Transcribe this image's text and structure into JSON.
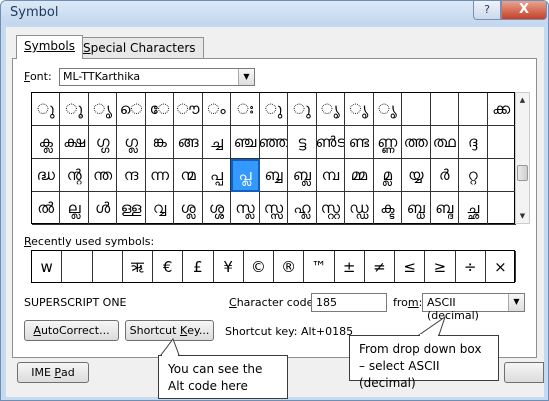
{
  "window": {
    "title": "Symbol",
    "help_glyph": "?",
    "close_glyph": "X"
  },
  "tabs": [
    {
      "label": "Symbols"
    },
    {
      "prefix": "S",
      "label_rest": "pecial Characters"
    }
  ],
  "font": {
    "label_key": "F",
    "label_rest": "ont:",
    "value": "ML-TTKarthika"
  },
  "symbol_grid": [
    [
      "ു",
      "ൂ",
      "ൃ",
      "െ",
      "േ",
      "ൗ",
      "ം",
      "ഃ",
      "ു",
      "ു",
      "ൃ",
      "ൃ",
      "ൃ",
      "",
      "",
      "",
      "ക്ക"
    ],
    [
      "ക്ല",
      "ക്ഷ",
      "ഗ്ഗ",
      "ഗ്ല",
      "ങ്ക",
      "ങ്ങ",
      "ച്ച",
      "ഞ്ച",
      "ഞ്ഞ",
      "ട്ട",
      "ൺട",
      "ണ്ട",
      "ണ്ണ",
      "ത്ത",
      "ത്ഥ",
      "ദ്ദ",
      ""
    ],
    [
      "ദ്ധ",
      "ന്റ",
      "ന്ത",
      "ന്ദ",
      "ന്ന",
      "ന്മ",
      "പ്പ",
      "പ്ല",
      "ബ്ബ",
      "ബ്ല",
      "മ്പ",
      "മ്മ",
      "മ്ല",
      "യ്യ",
      "ർ",
      "റ്റ",
      ""
    ],
    [
      "ൽ",
      "ല്ല",
      "ൾ",
      "ള്ള",
      "വ്വ",
      "ശ്ല",
      "ശ്ശ",
      "സ്ല",
      "സ്സ",
      "ഹ്ല",
      "സ്റ്റ",
      "ഡ്ഡ",
      "ക്ട",
      "ബ്ധ",
      "ബ്ദ",
      "ച്ഛ",
      ""
    ]
  ],
  "selected_cell": {
    "row": 2,
    "col": 7
  },
  "recent": {
    "label_key": "R",
    "label_rest": "ecently used symbols:",
    "symbols": [
      "w",
      "",
      "",
      "ऋ",
      "€",
      "£",
      "¥",
      "©",
      "®",
      "™",
      "±",
      "≠",
      "≤",
      "≥",
      "÷",
      "×"
    ]
  },
  "char_name": "SUPERSCRIPT ONE",
  "char_code": {
    "label_key": "C",
    "label_rest": "haracter code:",
    "value": "185"
  },
  "from": {
    "label_rest": "fro",
    "label_key": "m",
    "label_end": ":",
    "value": "ASCII (decimal)"
  },
  "buttons": {
    "autocorrect_key": "A",
    "autocorrect_rest": "utoCorrect...",
    "shortcut_pre": "Shortcut ",
    "shortcut_key": "K",
    "shortcut_rest": "ey...",
    "ime_pre": "IME ",
    "ime_key": "P",
    "ime_rest": "ad"
  },
  "shortcut_key_text": "Shortcut key: Alt+0185",
  "callouts": {
    "alt_code": "You can see the Alt code here",
    "drop_down": "From drop down box – select ASCII (decimal)"
  },
  "colors": {
    "selection": "#3399ff",
    "title_bg": "#c5d9f1",
    "close": "#c5402a"
  }
}
